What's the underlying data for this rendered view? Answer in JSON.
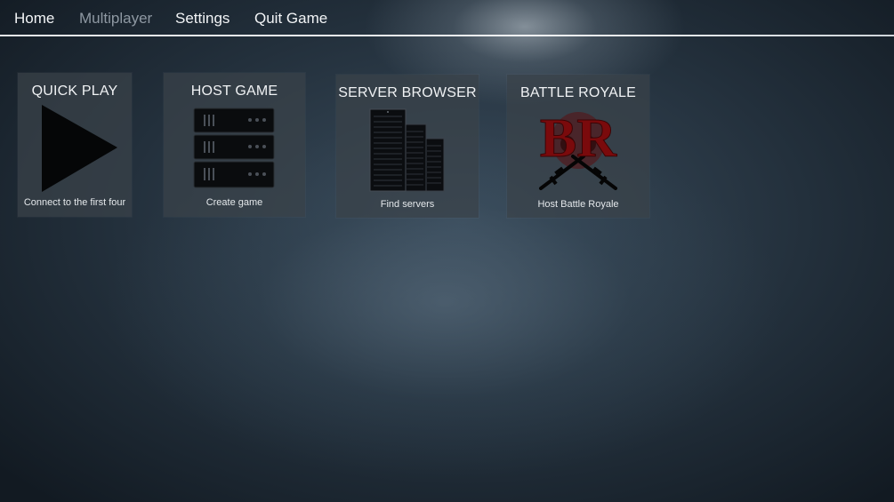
{
  "nav": {
    "items": [
      {
        "label": "Home",
        "active": false
      },
      {
        "label": "Multiplayer",
        "active": true
      },
      {
        "label": "Settings",
        "active": false
      },
      {
        "label": "Quit Game",
        "active": false
      }
    ]
  },
  "tiles": [
    {
      "title": "QUICK PLAY",
      "description": "Connect to the first four",
      "icon": "play-icon"
    },
    {
      "title": "HOST GAME",
      "description": "Create game",
      "icon": "server-rack-icon"
    },
    {
      "title": "SERVER BROWSER",
      "description": "Find servers",
      "icon": "server-towers-icon"
    },
    {
      "title": "BATTLE ROYALE",
      "description": "Host Battle Royale",
      "icon": "battle-royale-logo-icon",
      "logo_text": "BR"
    }
  ],
  "colors": {
    "nav_active": "#8e98a2",
    "nav_text": "#f2f4f6",
    "tile_bg": "#3a424a",
    "br_red": "#8a0c0c"
  }
}
